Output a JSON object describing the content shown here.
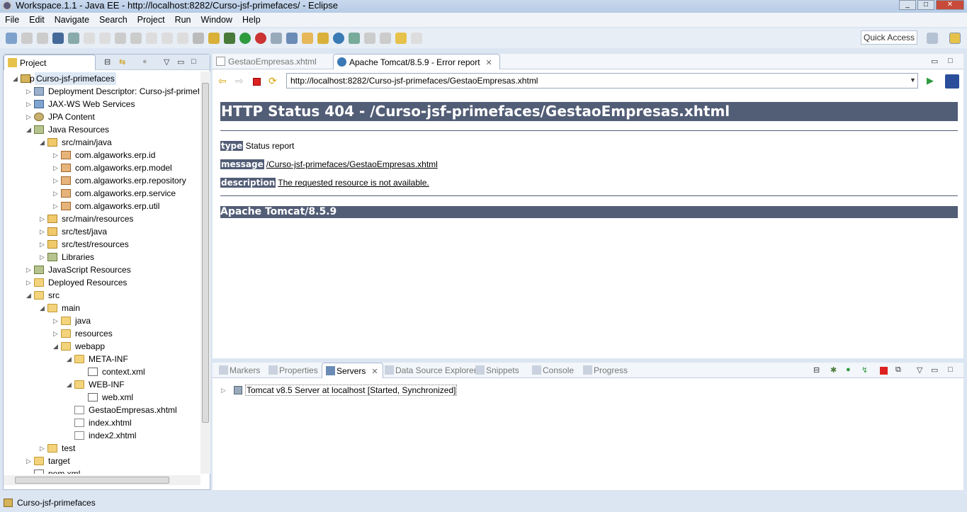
{
  "window": {
    "title": "Workspace.1.1 - Java EE - http://localhost:8282/Curso-jsf-primefaces/ - Eclipse"
  },
  "menu": [
    "File",
    "Edit",
    "Navigate",
    "Search",
    "Project",
    "Run",
    "Window",
    "Help"
  ],
  "toolbar": {
    "quick_access": "Quick Access"
  },
  "explorer": {
    "tab": "Project Explorer",
    "items": [
      {
        "label": "Curso-jsf-primefaces",
        "level": 0,
        "arrow": "open",
        "icon": "project"
      },
      {
        "label": "Deployment Descriptor: Curso-jsf-primefaces",
        "level": 1,
        "arrow": "closed",
        "icon": "dd"
      },
      {
        "label": "JAX-WS Web Services",
        "level": 1,
        "arrow": "closed",
        "icon": "service"
      },
      {
        "label": "JPA Content",
        "level": 1,
        "arrow": "closed",
        "icon": "jpa"
      },
      {
        "label": "Java Resources",
        "level": 1,
        "arrow": "open",
        "icon": "lib"
      },
      {
        "label": "src/main/java",
        "level": 2,
        "arrow": "open",
        "icon": "srcfolder"
      },
      {
        "label": "com.algaworks.erp.id",
        "level": 3,
        "arrow": "closed",
        "icon": "pkg"
      },
      {
        "label": "com.algaworks.erp.model",
        "level": 3,
        "arrow": "closed",
        "icon": "pkg"
      },
      {
        "label": "com.algaworks.erp.repository",
        "level": 3,
        "arrow": "closed",
        "icon": "pkg"
      },
      {
        "label": "com.algaworks.erp.service",
        "level": 3,
        "arrow": "closed",
        "icon": "pkg"
      },
      {
        "label": "com.algaworks.erp.util",
        "level": 3,
        "arrow": "closed",
        "icon": "pkg"
      },
      {
        "label": "src/main/resources",
        "level": 2,
        "arrow": "closed",
        "icon": "srcfolder"
      },
      {
        "label": "src/test/java",
        "level": 2,
        "arrow": "closed",
        "icon": "srcfolder"
      },
      {
        "label": "src/test/resources",
        "level": 2,
        "arrow": "closed",
        "icon": "srcfolder"
      },
      {
        "label": "Libraries",
        "level": 2,
        "arrow": "closed",
        "icon": "lib"
      },
      {
        "label": "JavaScript Resources",
        "level": 1,
        "arrow": "closed",
        "icon": "lib"
      },
      {
        "label": "Deployed Resources",
        "level": 1,
        "arrow": "closed",
        "icon": "folder"
      },
      {
        "label": "src",
        "level": 1,
        "arrow": "open",
        "icon": "folder"
      },
      {
        "label": "main",
        "level": 2,
        "arrow": "open",
        "icon": "folder"
      },
      {
        "label": "java",
        "level": 3,
        "arrow": "closed",
        "icon": "folder"
      },
      {
        "label": "resources",
        "level": 3,
        "arrow": "closed",
        "icon": "folder"
      },
      {
        "label": "webapp",
        "level": 3,
        "arrow": "open",
        "icon": "folder"
      },
      {
        "label": "META-INF",
        "level": 4,
        "arrow": "open",
        "icon": "folder"
      },
      {
        "label": "context.xml",
        "level": 5,
        "arrow": "none",
        "icon": "xml"
      },
      {
        "label": "WEB-INF",
        "level": 4,
        "arrow": "open",
        "icon": "folder"
      },
      {
        "label": "web.xml",
        "level": 5,
        "arrow": "none",
        "icon": "xml"
      },
      {
        "label": "GestaoEmpresas.xhtml",
        "level": 4,
        "arrow": "none",
        "icon": "file"
      },
      {
        "label": "index.xhtml",
        "level": 4,
        "arrow": "none",
        "icon": "file"
      },
      {
        "label": "index2.xhtml",
        "level": 4,
        "arrow": "none",
        "icon": "file"
      },
      {
        "label": "test",
        "level": 2,
        "arrow": "closed",
        "icon": "folder"
      },
      {
        "label": "target",
        "level": 1,
        "arrow": "closed",
        "icon": "folder"
      },
      {
        "label": "pom.xml",
        "level": 1,
        "arrow": "none",
        "icon": "maven"
      }
    ]
  },
  "editor": {
    "tabs": [
      "GestaoEmpresas.xhtml",
      "Apache Tomcat/8.5.9 - Error report"
    ],
    "url": "http://localhost:8282/Curso-jsf-primefaces/GestaoEmpresas.xhtml",
    "page": {
      "heading": "HTTP Status 404 - /Curso-jsf-primefaces/GestaoEmpresas.xhtml",
      "type_label": "type",
      "type_value": "Status report",
      "message_label": "message",
      "message_value": "/Curso-jsf-primefaces/GestaoEmpresas.xhtml",
      "description_label": "description",
      "description_value": "The requested resource is not available.",
      "footer": "Apache Tomcat/8.5.9"
    }
  },
  "bottom": {
    "tabs": [
      "Markers",
      "Properties",
      "Servers",
      "Data Source Explorer",
      "Snippets",
      "Console",
      "Progress"
    ],
    "server": "Tomcat v8.5 Server at localhost  [Started, Synchronized]"
  },
  "status": {
    "text": "Curso-jsf-primefaces"
  }
}
